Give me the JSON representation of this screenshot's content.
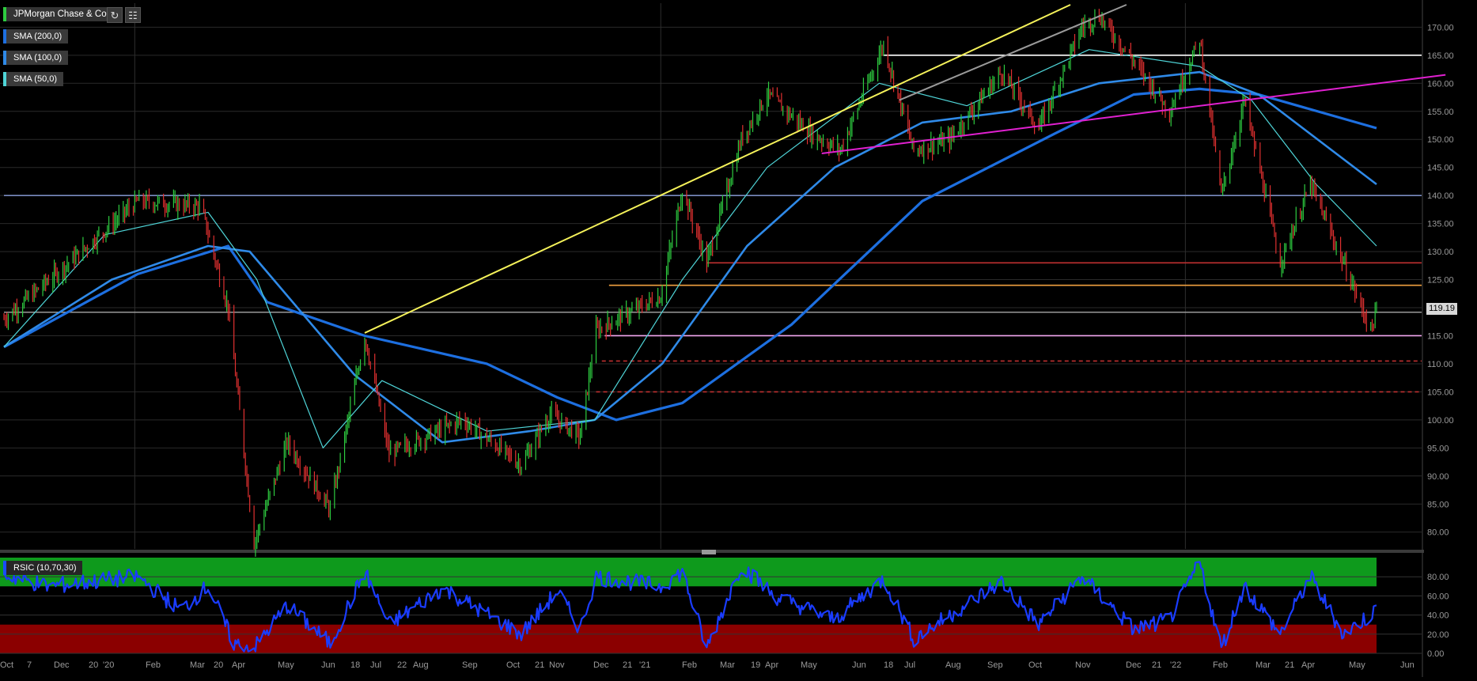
{
  "header": {
    "symbol_label": "JPMorgan Chase & Co",
    "refresh_icon": "refresh-icon",
    "settings_icon": "chart-settings-icon"
  },
  "legend": {
    "sma200": "SMA (200,0)",
    "sma100": "SMA (100,0)",
    "sma50": "SMA (50,0)",
    "rsi": "RSIC (10,70,30)"
  },
  "last_price": "119.19",
  "colors": {
    "up_bar": "#2ecc40",
    "down_bar": "#e03030",
    "sma200": "#1d6fe0",
    "sma100": "#2f8ae8",
    "sma50": "#4fd5d8",
    "rsi_line": "#1a3cff",
    "overbought_band": "#0e9a1c",
    "oversold_band": "#8b0000",
    "trend_yellow": "#f5f25a",
    "trend_magenta": "#e020d0",
    "level_white": "#ffffff",
    "level_slate": "#7a8bc0",
    "level_red": "#c03030",
    "level_orange": "#f0a040",
    "level_pink": "#f3a8f0"
  },
  "chart_data": [
    {
      "type": "candlestick",
      "title": "JPMorgan Chase & Co",
      "ylim": [
        77,
        174
      ],
      "y_ticks": [
        "80.00",
        "85.00",
        "90.00",
        "95.00",
        "100.00",
        "105.00",
        "110.00",
        "115.00",
        "120.00",
        "125.00",
        "130.00",
        "135.00",
        "140.00",
        "145.00",
        "150.00",
        "155.00",
        "160.00",
        "165.00",
        "170.00"
      ],
      "x_tick_labels": [
        "Oct",
        "7",
        "Dec",
        "20",
        "'20",
        "Feb",
        "Mar",
        "20",
        "Apr",
        "May",
        "Jun",
        "18",
        "Jul",
        "22",
        "Aug",
        "Sep",
        "Oct",
        "21",
        "Nov",
        "Dec",
        "21",
        "'21",
        "Feb",
        "Mar",
        "19",
        "Apr",
        "May",
        "Jun",
        "18",
        "Jul",
        "Aug",
        "Sep",
        "Oct",
        "Nov",
        "Dec",
        "21",
        "'22",
        "Feb",
        "Mar",
        "21",
        "Apr",
        "May",
        "Jun"
      ],
      "price_path": [
        [
          "2019-10-01",
          118
        ],
        [
          "2019-11-15",
          128
        ],
        [
          "2020-01-02",
          139
        ],
        [
          "2020-02-15",
          138
        ],
        [
          "2020-03-05",
          120
        ],
        [
          "2020-03-23",
          78
        ],
        [
          "2020-04-15",
          96
        ],
        [
          "2020-05-15",
          84
        ],
        [
          "2020-06-08",
          115
        ],
        [
          "2020-06-25",
          94
        ],
        [
          "2020-08-15",
          100
        ],
        [
          "2020-09-25",
          92
        ],
        [
          "2020-10-15",
          101
        ],
        [
          "2020-11-05",
          97
        ],
        [
          "2020-11-16",
          116
        ],
        [
          "2020-12-31",
          122
        ],
        [
          "2021-01-15",
          141
        ],
        [
          "2021-02-01",
          128
        ],
        [
          "2021-02-25",
          150
        ],
        [
          "2021-03-15",
          158
        ],
        [
          "2021-04-15",
          151
        ],
        [
          "2021-05-05",
          148
        ],
        [
          "2021-06-04",
          167
        ],
        [
          "2021-06-25",
          148
        ],
        [
          "2021-07-20",
          150
        ],
        [
          "2021-08-25",
          162
        ],
        [
          "2021-09-20",
          152
        ],
        [
          "2021-10-20",
          170
        ],
        [
          "2021-11-01",
          172
        ],
        [
          "2021-11-25",
          164
        ],
        [
          "2021-12-20",
          155
        ],
        [
          "2022-01-10",
          168
        ],
        [
          "2022-01-25",
          140
        ],
        [
          "2022-02-10",
          157
        ],
        [
          "2022-03-07",
          128
        ],
        [
          "2022-03-28",
          142
        ],
        [
          "2022-04-20",
          128
        ],
        [
          "2022-05-09",
          116
        ],
        [
          "2022-05-13",
          119.19
        ]
      ],
      "series": [
        {
          "name": "SMA (200,0)",
          "values": [
            [
              "2019-10-01",
              113
            ],
            [
              "2020-01-02",
              126
            ],
            [
              "2020-03-05",
              131
            ],
            [
              "2020-04-01",
              121
            ],
            [
              "2020-06-08",
              115
            ],
            [
              "2020-09-01",
              110
            ],
            [
              "2020-10-20",
              104
            ],
            [
              "2020-11-30",
              100
            ],
            [
              "2021-01-15",
              103
            ],
            [
              "2021-04-01",
              117
            ],
            [
              "2021-07-01",
              139
            ],
            [
              "2021-10-01",
              151
            ],
            [
              "2021-11-25",
              158
            ],
            [
              "2022-01-10",
              159
            ],
            [
              "2022-02-20",
              158
            ],
            [
              "2022-05-13",
              152
            ]
          ]
        },
        {
          "name": "SMA (100,0)",
          "values": [
            [
              "2019-10-01",
              113
            ],
            [
              "2019-12-15",
              125
            ],
            [
              "2020-02-20",
              131
            ],
            [
              "2020-03-20",
              130
            ],
            [
              "2020-06-01",
              108
            ],
            [
              "2020-08-01",
              96
            ],
            [
              "2020-10-01",
              98
            ],
            [
              "2020-11-15",
              100
            ],
            [
              "2021-01-01",
              110
            ],
            [
              "2021-03-01",
              131
            ],
            [
              "2021-05-01",
              145
            ],
            [
              "2021-07-01",
              153
            ],
            [
              "2021-09-01",
              155
            ],
            [
              "2021-11-01",
              160
            ],
            [
              "2022-01-10",
              162
            ],
            [
              "2022-02-20",
              158
            ],
            [
              "2022-05-13",
              142
            ]
          ]
        },
        {
          "name": "SMA (50,0)",
          "values": [
            [
              "2019-10-01",
              113
            ],
            [
              "2019-12-10",
              133
            ],
            [
              "2020-02-20",
              137
            ],
            [
              "2020-03-25",
              125
            ],
            [
              "2020-05-10",
              95
            ],
            [
              "2020-06-20",
              107
            ],
            [
              "2020-09-01",
              98
            ],
            [
              "2020-11-15",
              100
            ],
            [
              "2021-01-15",
              125
            ],
            [
              "2021-03-15",
              145
            ],
            [
              "2021-06-01",
              160
            ],
            [
              "2021-08-01",
              156
            ],
            [
              "2021-10-25",
              166
            ],
            [
              "2022-01-10",
              163
            ],
            [
              "2022-02-15",
              157
            ],
            [
              "2022-04-01",
              142
            ],
            [
              "2022-05-13",
              131
            ]
          ]
        }
      ],
      "horizontal_levels": [
        {
          "value": 165,
          "color": "#ffffff",
          "from": "2021-06-04",
          "style": "solid"
        },
        {
          "value": 140,
          "color": "#7a8bc0",
          "from": "2019-10-01",
          "style": "solid"
        },
        {
          "value": 128,
          "color": "#c03030",
          "from": "2021-02-01",
          "style": "solid"
        },
        {
          "value": 124,
          "color": "#f0a040",
          "from": "2020-11-25",
          "style": "solid"
        },
        {
          "value": 119.19,
          "color": "#9a9a9a",
          "from": "2019-10-01",
          "style": "solid"
        },
        {
          "value": 115,
          "color": "#f3a8f0",
          "from": "2020-11-22",
          "style": "solid"
        },
        {
          "value": 110.5,
          "color": "#c03030",
          "from": "2020-11-20",
          "style": "dashed"
        },
        {
          "value": 105,
          "color": "#c03030",
          "from": "2020-11-16",
          "style": "dashed"
        }
      ],
      "trendlines": [
        {
          "color": "#f5f25a",
          "from": [
            "2020-06-08",
            115.5
          ],
          "to": [
            "2021-10-12",
            174
          ]
        },
        {
          "color": "#9a9a9a",
          "from": [
            "2021-06-15",
            157
          ],
          "to": [
            "2021-11-20",
            174
          ]
        },
        {
          "color": "#e020d0",
          "from": [
            "2021-04-22",
            147.5
          ],
          "to": [
            "2022-06-30",
            161.5
          ]
        }
      ]
    },
    {
      "type": "line",
      "title": "RSIC (10,70,30)",
      "ylim": [
        0,
        100
      ],
      "y_ticks": [
        "0.00",
        "20.00",
        "40.00",
        "60.00",
        "80.00"
      ],
      "overbought": 70,
      "oversold": 30,
      "rsi_path": [
        [
          "2019-10-01",
          82
        ],
        [
          "2019-11-01",
          70
        ],
        [
          "2020-01-02",
          80
        ],
        [
          "2020-02-01",
          45
        ],
        [
          "2020-02-20",
          70
        ],
        [
          "2020-03-09",
          10
        ],
        [
          "2020-03-23",
          5
        ],
        [
          "2020-04-15",
          50
        ],
        [
          "2020-05-15",
          10
        ],
        [
          "2020-06-08",
          85
        ],
        [
          "2020-06-25",
          30
        ],
        [
          "2020-08-01",
          68
        ],
        [
          "2020-09-25",
          20
        ],
        [
          "2020-10-20",
          65
        ],
        [
          "2020-11-05",
          25
        ],
        [
          "2020-11-16",
          80
        ],
        [
          "2020-12-31",
          70
        ],
        [
          "2021-01-15",
          85
        ],
        [
          "2021-02-01",
          5
        ],
        [
          "2021-02-25",
          92
        ],
        [
          "2021-03-20",
          60
        ],
        [
          "2021-05-01",
          35
        ],
        [
          "2021-06-04",
          78
        ],
        [
          "2021-06-25",
          15
        ],
        [
          "2021-08-25",
          75
        ],
        [
          "2021-09-20",
          30
        ],
        [
          "2021-10-20",
          80
        ],
        [
          "2021-11-25",
          25
        ],
        [
          "2021-12-20",
          35
        ],
        [
          "2022-01-10",
          95
        ],
        [
          "2022-01-25",
          5
        ],
        [
          "2022-02-10",
          70
        ],
        [
          "2022-03-07",
          20
        ],
        [
          "2022-03-28",
          80
        ],
        [
          "2022-04-20",
          20
        ],
        [
          "2022-05-09",
          40
        ],
        [
          "2022-05-13",
          47
        ]
      ]
    }
  ]
}
